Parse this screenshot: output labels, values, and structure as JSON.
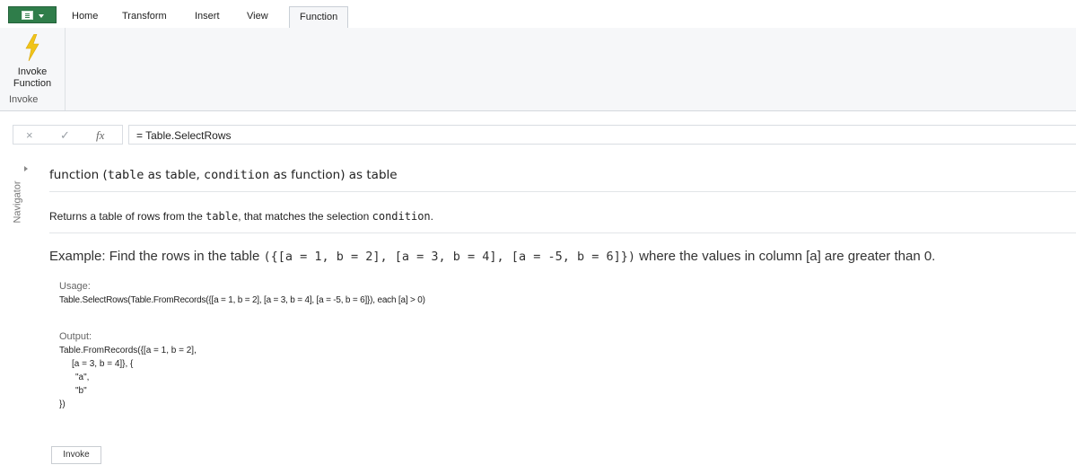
{
  "ribbon": {
    "tabs": [
      {
        "label": "Home"
      },
      {
        "label": "Transform"
      },
      {
        "label": "Insert"
      },
      {
        "label": "View"
      },
      {
        "label": "Function",
        "active": true
      }
    ],
    "invoke_button": {
      "line1": "Invoke",
      "line2": "Function",
      "icon": "lightning-bolt-icon"
    },
    "group_caption": "Invoke"
  },
  "formula_bar": {
    "cancel_icon": "×",
    "confirm_icon": "✓",
    "fx_label": "fx",
    "value": "= Table.SelectRows"
  },
  "navigator": {
    "label": "Navigator"
  },
  "function_info": {
    "signature": {
      "prefix": "function (",
      "p1": "table",
      "t1": " as table, ",
      "p2": "condition",
      "t2": " as function) as table"
    },
    "description": {
      "before": "Returns a table of rows from the ",
      "code1": "table",
      "middle": ", that matches the selection ",
      "code2": "condition",
      "after": "."
    },
    "example": {
      "before": "Example: Find the rows in the table ",
      "code": "({[a = 1, b = 2], [a = 3, b = 4], [a = -5, b = 6]})",
      "after": " where the values in column [a] are greater than 0."
    },
    "usage_label": "Usage:",
    "usage_code": "Table.SelectRows(Table.FromRecords({[a = 1, b = 2], [a = 3, b = 4], [a = -5, b = 6]}), each [a] > 0)",
    "output_label": "Output:",
    "output_lines": [
      "Table.FromRecords({[a = 1, b = 2],",
      "[a = 3, b = 4]}, {",
      "\"a\",",
      "\"b\"",
      "})"
    ],
    "invoke_label": "Invoke"
  },
  "colors": {
    "file_button": "#2f7d4a",
    "bolt": "#f0c419"
  }
}
